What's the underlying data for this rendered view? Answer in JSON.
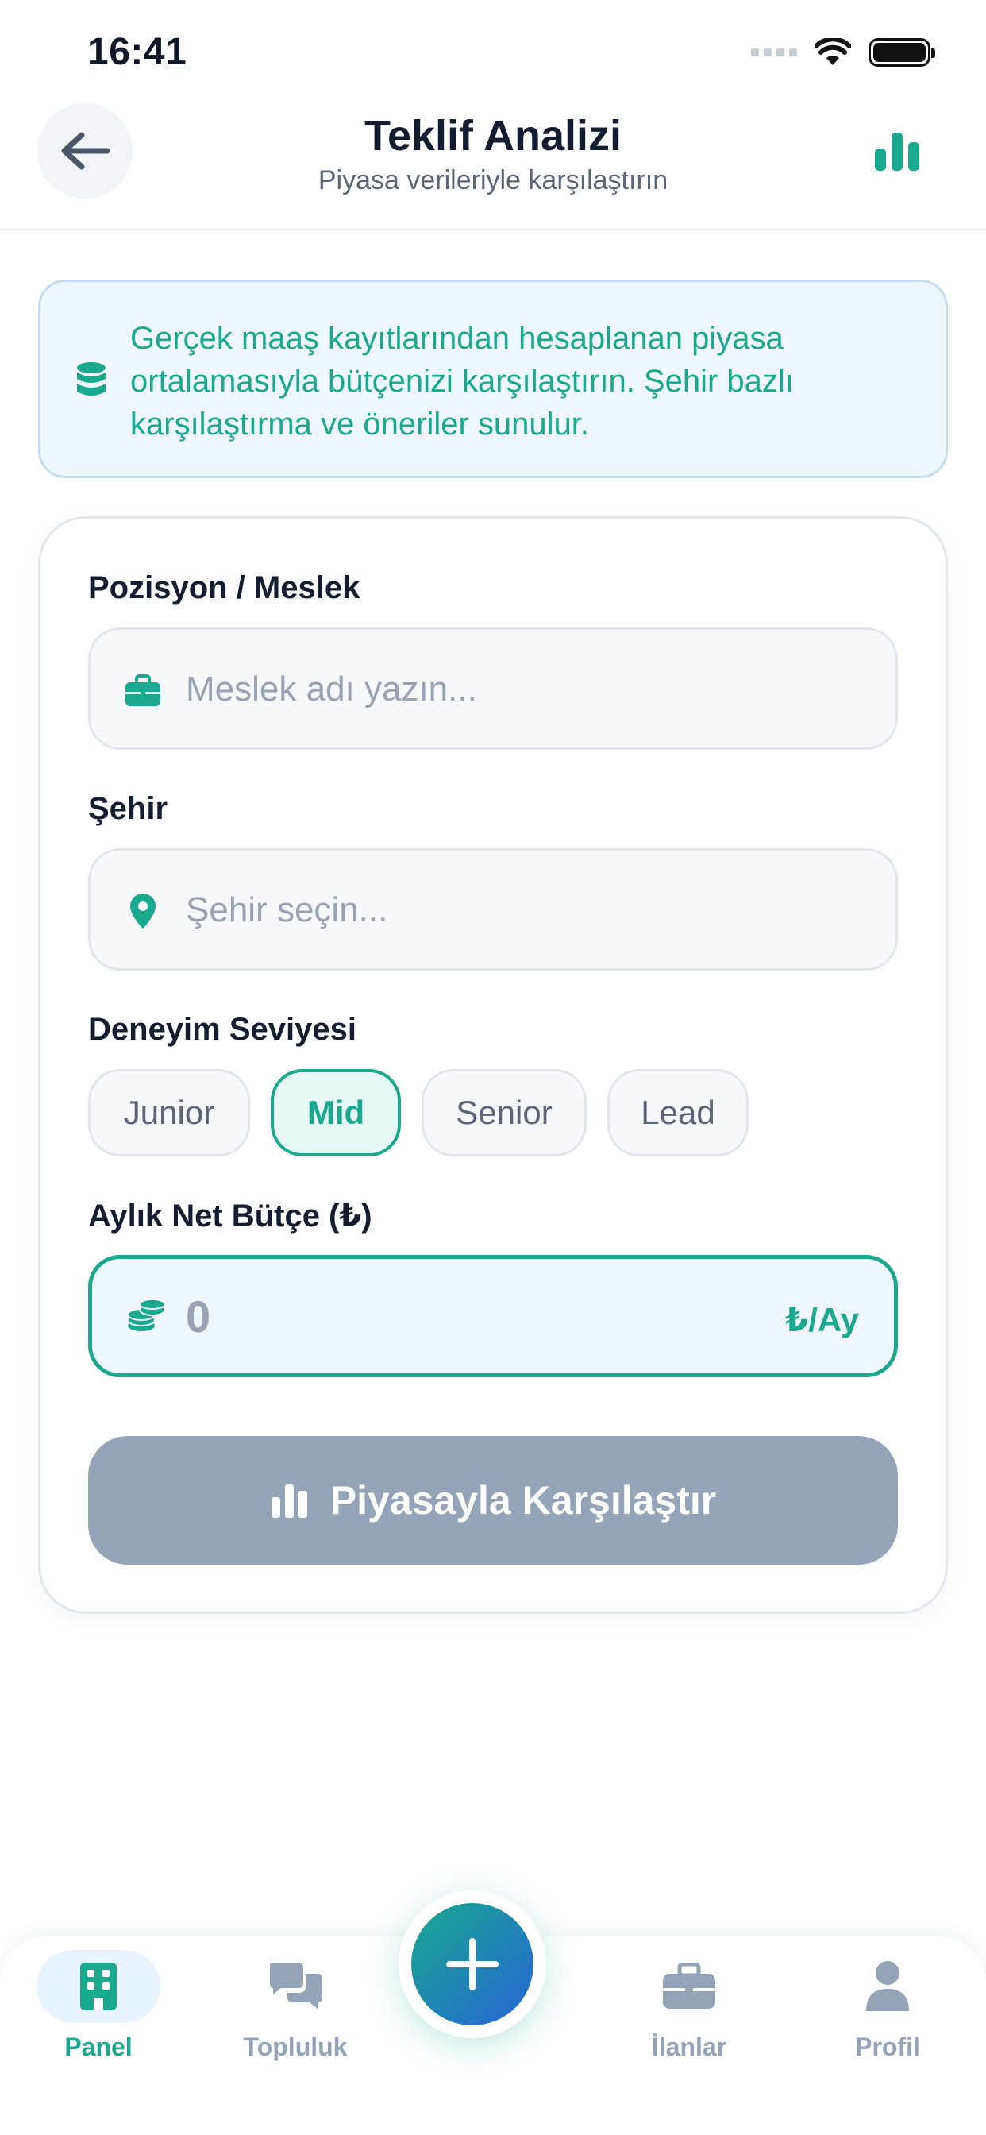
{
  "status_bar": {
    "time": "16:41"
  },
  "header": {
    "title": "Teklif Analizi",
    "subtitle": "Piyasa verileriyle karşılaştırın"
  },
  "info_banner": {
    "text": "Gerçek maaş kayıtlarından hesaplanan piyasa ortalamasıyla bütçenizi karşılaştırın. Şehir bazlı karşılaştırma ve öneriler sunulur."
  },
  "form": {
    "position": {
      "label": "Pozisyon / Meslek",
      "placeholder": "Meslek adı yazın..."
    },
    "city": {
      "label": "Şehir",
      "placeholder": "Şehir seçin..."
    },
    "experience": {
      "label": "Deneyim Seviyesi",
      "options": [
        "Junior",
        "Mid",
        "Senior",
        "Lead"
      ],
      "selected": "Mid"
    },
    "budget": {
      "label": "Aylık Net Bütçe (₺)",
      "value": "0",
      "unit": "₺/Ay"
    },
    "submit_label": "Piyasayla Karşılaştır"
  },
  "bottom_nav": {
    "items": [
      {
        "label": "Panel",
        "icon": "building-icon",
        "active": true
      },
      {
        "label": "Topluluk",
        "icon": "chat-bubbles-icon",
        "active": false
      },
      {
        "label": "İlanlar",
        "icon": "briefcase-icon",
        "active": false
      },
      {
        "label": "Profil",
        "icon": "user-icon",
        "active": false
      }
    ],
    "fab_icon": "plus-icon"
  },
  "colors": {
    "accent": "#1aa88e",
    "info_bg": "#eef6fe",
    "disabled_button": "#94a3b8",
    "title": "#141d2f"
  }
}
